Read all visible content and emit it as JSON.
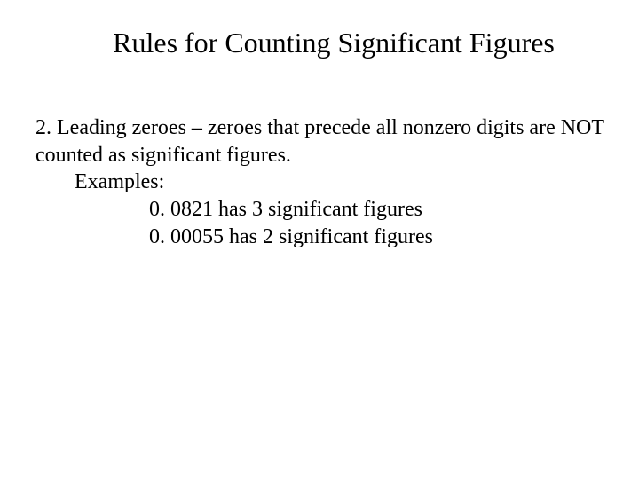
{
  "title": "Rules for Counting Significant Figures",
  "rule_number_prefix": "2.  ",
  "rule_text_part1": "Leading zeroes – zeroes that precede all nonzero digits are NOT counted as significant figures.",
  "examples_label": "Examples:",
  "example_1": "0. 0821 has 3 significant figures",
  "example_2": "0. 00055 has 2 significant figures"
}
